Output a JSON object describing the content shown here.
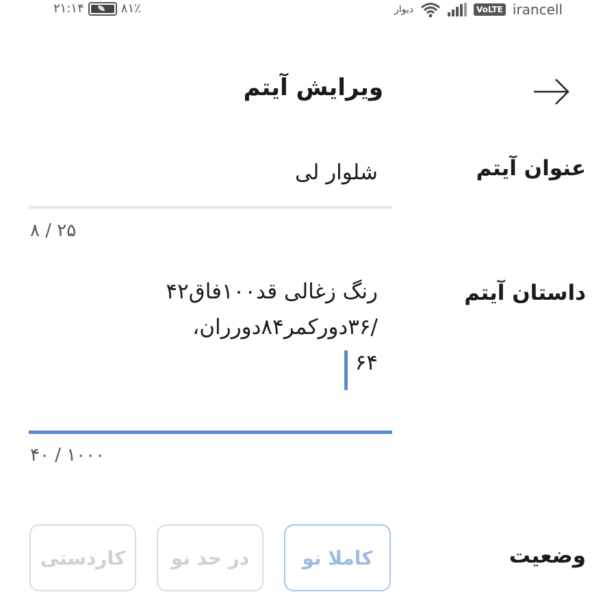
{
  "status_bar": {
    "time": "۲۱:۱۴",
    "battery": "۸۱٪",
    "extra_label": "دیوار",
    "volte": "VoLTE",
    "carrier": "irancell"
  },
  "header": {
    "title": "ویرایش آیتم",
    "back_icon": "arrow-right-icon"
  },
  "form": {
    "title_label": "عنوان آیتم",
    "title_value": "شلوار لی",
    "title_counter": "۸ / ۲۵",
    "story_label": "داستان آیتم",
    "story_lines": [
      "رنگ زغالی قد۱۰۰فاق۴۲",
      "/۳۶دورکمر۸۴دورران،",
      "۶۴"
    ],
    "story_counter": "۴۰ / ۱۰۰۰",
    "status_label": "وضعیت",
    "status_options": [
      "کاملا نو",
      "در حد نو",
      "کاردستی"
    ],
    "status_selected": "کاملا نو"
  },
  "colors": {
    "accent": "#5a8bd0",
    "selected_chip_border": "#a9c3e8",
    "disabled_text": "#d0d0d0"
  }
}
